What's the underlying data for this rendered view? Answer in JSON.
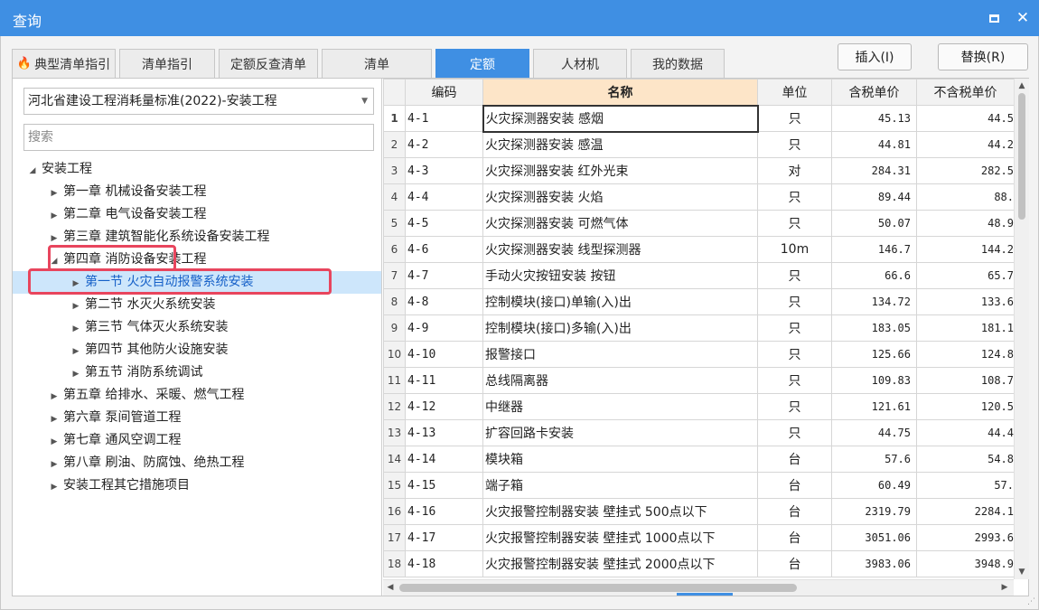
{
  "window": {
    "title": "查询"
  },
  "tabs": [
    {
      "label": "典型清单指引",
      "icon": "fire-icon",
      "active": false
    },
    {
      "label": "清单指引",
      "active": false
    },
    {
      "label": "定额反查清单",
      "active": false
    },
    {
      "label": "清单",
      "active": false
    },
    {
      "label": "定额",
      "active": true
    },
    {
      "label": "人材机",
      "active": false
    },
    {
      "label": "我的数据",
      "active": false
    }
  ],
  "actions": {
    "insert_label": "插入(I)",
    "replace_label": "替换(R)"
  },
  "left": {
    "library_select": "河北省建设工程消耗量标准(2022)-安装工程",
    "search_placeholder": "搜索",
    "tree": [
      {
        "label": "安装工程",
        "level": 0,
        "expanded": true
      },
      {
        "label": "第一章 机械设备安装工程",
        "level": 1
      },
      {
        "label": "第二章 电气设备安装工程",
        "level": 1
      },
      {
        "label": "第三章 建筑智能化系统设备安装工程",
        "level": 1
      },
      {
        "label": "第四章 消防设备安装工程",
        "level": 1,
        "expanded": true
      },
      {
        "label": "第一节 火灾自动报警系统安装",
        "level": 2,
        "selected": true
      },
      {
        "label": "第二节 水灭火系统安装",
        "level": 2
      },
      {
        "label": "第三节 气体灭火系统安装",
        "level": 2
      },
      {
        "label": "第四节 其他防火设施安装",
        "level": 2
      },
      {
        "label": "第五节 消防系统调试",
        "level": 2
      },
      {
        "label": "第五章 给排水、采暖、燃气工程",
        "level": 1
      },
      {
        "label": "第六章 泵间管道工程",
        "level": 1
      },
      {
        "label": "第七章 通风空调工程",
        "level": 1
      },
      {
        "label": "第八章 刷油、防腐蚀、绝热工程",
        "level": 1
      },
      {
        "label": "安装工程其它措施项目",
        "level": 1
      }
    ]
  },
  "grid": {
    "columns": {
      "code": "编码",
      "name": "名称",
      "unit": "单位",
      "tax_price": "含税单价",
      "notax_price": "不含税单价"
    },
    "rows": [
      {
        "idx": "1",
        "code": "4-1",
        "name": "火灾探测器安装 感烟",
        "unit": "只",
        "tax": "45.13",
        "notax": "44.5"
      },
      {
        "idx": "2",
        "code": "4-2",
        "name": "火灾探测器安装 感温",
        "unit": "只",
        "tax": "44.81",
        "notax": "44.2"
      },
      {
        "idx": "3",
        "code": "4-3",
        "name": "火灾探测器安装 红外光束",
        "unit": "对",
        "tax": "284.31",
        "notax": "282.5"
      },
      {
        "idx": "4",
        "code": "4-4",
        "name": "火灾探测器安装 火焰",
        "unit": "只",
        "tax": "89.44",
        "notax": "88."
      },
      {
        "idx": "5",
        "code": "4-5",
        "name": "火灾探测器安装 可燃气体",
        "unit": "只",
        "tax": "50.07",
        "notax": "48.9"
      },
      {
        "idx": "6",
        "code": "4-6",
        "name": "火灾探测器安装 线型探测器",
        "unit": "10m",
        "tax": "146.7",
        "notax": "144.2"
      },
      {
        "idx": "7",
        "code": "4-7",
        "name": "手动火灾按钮安装 按钮",
        "unit": "只",
        "tax": "66.6",
        "notax": "65.7"
      },
      {
        "idx": "8",
        "code": "4-8",
        "name": "控制模块(接口)单输(入)出",
        "unit": "只",
        "tax": "134.72",
        "notax": "133.6"
      },
      {
        "idx": "9",
        "code": "4-9",
        "name": "控制模块(接口)多输(入)出",
        "unit": "只",
        "tax": "183.05",
        "notax": "181.1"
      },
      {
        "idx": "10",
        "code": "4-10",
        "name": "报警接口",
        "unit": "只",
        "tax": "125.66",
        "notax": "124.8"
      },
      {
        "idx": "11",
        "code": "4-11",
        "name": "总线隔离器",
        "unit": "只",
        "tax": "109.83",
        "notax": "108.7"
      },
      {
        "idx": "12",
        "code": "4-12",
        "name": "中继器",
        "unit": "只",
        "tax": "121.61",
        "notax": "120.5"
      },
      {
        "idx": "13",
        "code": "4-13",
        "name": "扩容回路卡安装",
        "unit": "只",
        "tax": "44.75",
        "notax": "44.4"
      },
      {
        "idx": "14",
        "code": "4-14",
        "name": "模块箱",
        "unit": "台",
        "tax": "57.6",
        "notax": "54.8"
      },
      {
        "idx": "15",
        "code": "4-15",
        "name": "端子箱",
        "unit": "台",
        "tax": "60.49",
        "notax": "57."
      },
      {
        "idx": "16",
        "code": "4-16",
        "name": "火灾报警控制器安装 壁挂式 500点以下",
        "unit": "台",
        "tax": "2319.79",
        "notax": "2284.1"
      },
      {
        "idx": "17",
        "code": "4-17",
        "name": "火灾报警控制器安装 壁挂式 1000点以下",
        "unit": "台",
        "tax": "3051.06",
        "notax": "2993.6"
      },
      {
        "idx": "18",
        "code": "4-18",
        "name": "火灾报警控制器安装 壁挂式 2000点以下",
        "unit": "台",
        "tax": "3983.06",
        "notax": "3948.9"
      }
    ]
  }
}
